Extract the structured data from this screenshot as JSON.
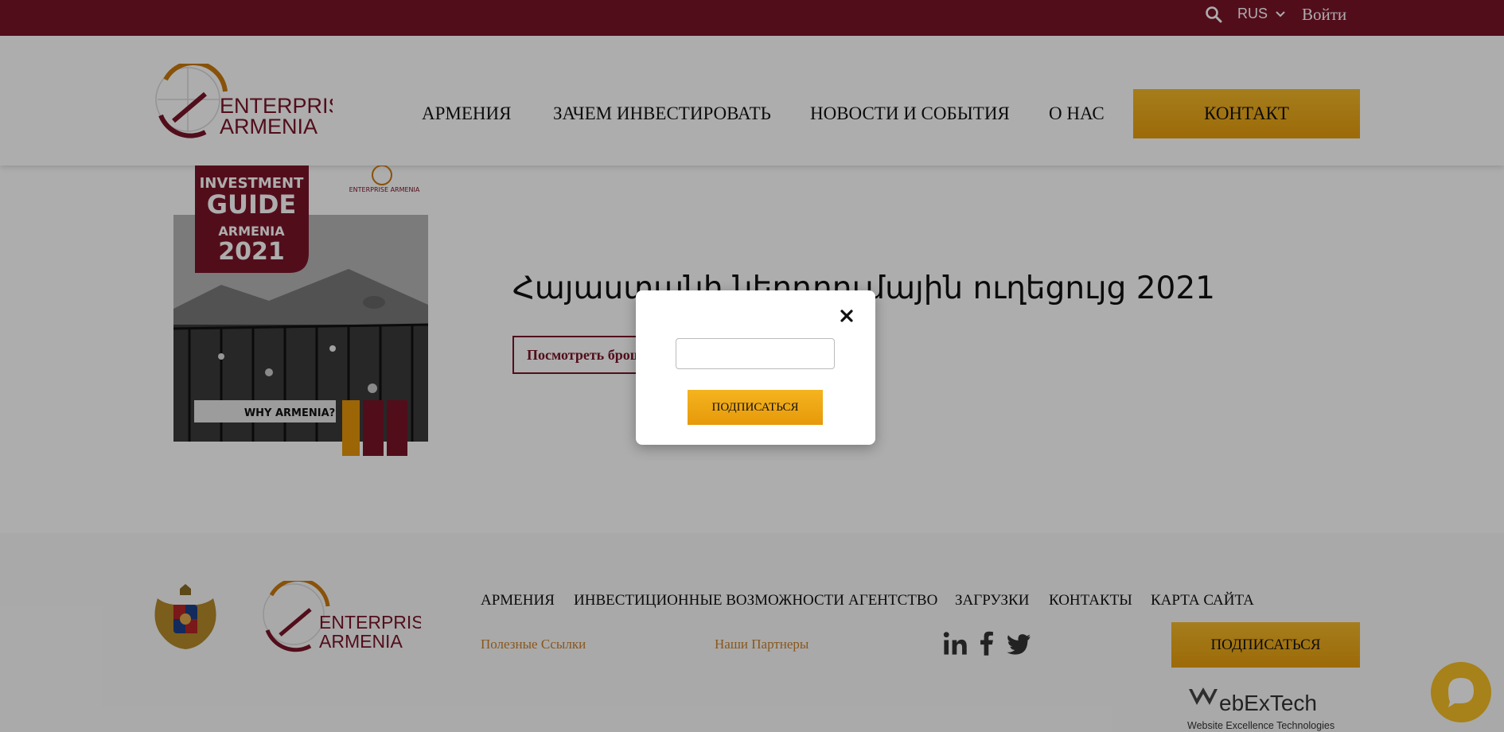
{
  "topbar": {
    "language": "RUS",
    "login": "Войти",
    "icons": [
      "search-icon",
      "chevron-down-icon"
    ]
  },
  "header": {
    "logo": {
      "line1": "ENTERPRISE",
      "line2": "ARMENIA"
    },
    "nav": [
      "АРМЕНИЯ",
      "ЗАЧЕМ ИНВЕСТИРОВАТЬ",
      "НОВОСТИ И СОБЫТИЯ",
      "О НАС"
    ],
    "contact_label": "КОНТАКТ"
  },
  "main": {
    "guide_cover": {
      "line1": "INVESTMENT",
      "line2": "GUIDE",
      "line3": "ARMENIA",
      "year": "2021",
      "tagline": "WHY ARMENIA?",
      "brand": "ENTERPRISE ARMENIA"
    },
    "title": "Հայաստանի ներդրումային ուղեցույց 2021",
    "brochure_button": "Посмотреть брошюру"
  },
  "footer": {
    "logo": {
      "line1": "ENTERPRISE",
      "line2": "ARMENIA"
    },
    "nav": [
      "АРМЕНИЯ",
      "ИНВЕСТИЦИОННЫЕ ВОЗМОЖНОСТИ",
      "АГЕНТСТВО",
      "ЗАГРУЗКИ",
      "КОНТАКТЫ",
      "КАРТА САЙТА"
    ],
    "useful_links": "Полезные Ссылки",
    "partners": "Наши Партнеры",
    "subscribe_label": "ПОДПИСАТЬСЯ",
    "social": [
      "linkedin-icon",
      "facebook-icon",
      "twitter-icon"
    ],
    "webex": {
      "name": "ebExTech",
      "tagline": "Website Excellence Technologies"
    }
  },
  "modal": {
    "email_value": "",
    "subscribe_label": "ПОДПИСАТЬСЯ"
  },
  "colors": {
    "brand": "#7a1428",
    "accent": "#f0ad1c",
    "link": "#c9802a"
  }
}
